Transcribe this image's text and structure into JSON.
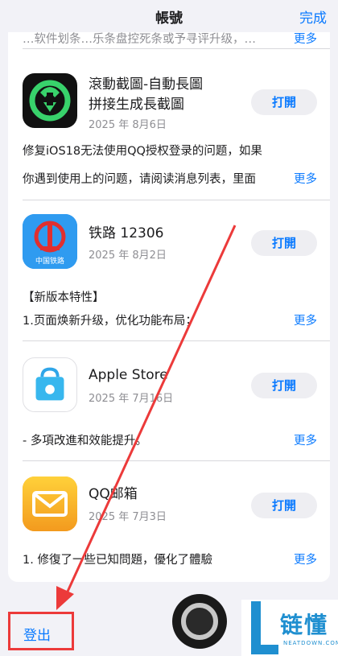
{
  "navbar": {
    "title": "帳號",
    "done_label": "完成"
  },
  "top_partial": {
    "text": "…软件划条…乐条盘控死条或予寻评升级，…",
    "more_label": "更多"
  },
  "apps": [
    {
      "name_line1": "滾動截圖-自動長圖",
      "name_line2": "拼接生成長截圖",
      "date": "2025 年 8月6日",
      "button_label": "打開",
      "notes_line1": "修复iOS18无法使用QQ授权登录的问题，如果",
      "notes_line2": "你遇到使用上的问题，请阅读消息列表，里面",
      "more_label": "更多"
    },
    {
      "name_line1": "铁路 12306",
      "date": "2025 年 8月2日",
      "button_label": "打開",
      "icon_caption": "中国铁路",
      "notes_line1": "【新版本特性】",
      "notes_line2": "1.页面焕新升级，优化功能布局；",
      "more_label": "更多"
    },
    {
      "name_line1": "Apple Store",
      "date": "2025 年 7月16日",
      "button_label": "打開",
      "notes_line1": "- 多項改進和效能提升。",
      "more_label": "更多"
    },
    {
      "name_line1": "QQ邮箱",
      "date": "2025 年 7月3日",
      "button_label": "打開",
      "notes_line1": "1. 修復了一些已知問題，優化了體驗",
      "more_label": "更多"
    }
  ],
  "logout": {
    "label": "登出"
  },
  "watermark": {
    "brand": "链懂",
    "sub": "NEATDOWN.COM"
  },
  "colors": {
    "accent": "#0a7aff",
    "annotation": "#ec3a3a",
    "background": "#f2f2f7"
  }
}
